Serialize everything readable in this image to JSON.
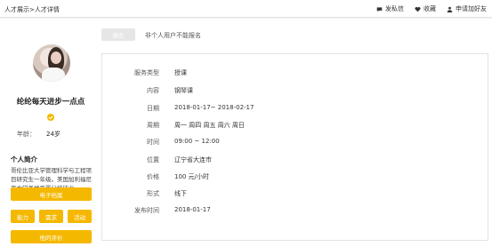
{
  "topbar": {
    "breadcrumb": "人才展示>人才详情",
    "actions": [
      {
        "label": "发私信",
        "icon": "chat-icon"
      },
      {
        "label": "收藏",
        "icon": "heart-icon"
      },
      {
        "label": "申请加好友",
        "icon": "person-icon"
      }
    ]
  },
  "profile": {
    "name": "纶纶每天进步一点点",
    "age_label": "年龄：",
    "age_value": "24岁",
    "intro_title": "个人简介",
    "intro_text": "哥伦比亚大学管理科学与工程项目研究生一年级。美国加利福尼亚大学圣地亚哥分校毕业。",
    "buttons": {
      "resume": "电子档案",
      "ability": "能力",
      "demand": "需求",
      "activity": "活动",
      "review": "他的评价"
    }
  },
  "main": {
    "disabled_button": "报名",
    "notice": "非个人用户不能报名",
    "details": [
      {
        "key": "服务类型",
        "value": "授课"
      },
      {
        "key": "内容",
        "value": "钢琴课"
      },
      {
        "key": "日期",
        "value": "2018-01-17~ 2018-02-17"
      },
      {
        "key": "周期",
        "value": "周一 周四 周五 周六 周日"
      },
      {
        "key": "时间",
        "value": "09:00 ~ 12:00"
      },
      {
        "key": "位置",
        "value": "辽宁省大连市"
      },
      {
        "key": "价格",
        "value": "100 元/小时"
      },
      {
        "key": "形式",
        "value": "线下"
      },
      {
        "key": "发布时间",
        "value": "2018-01-17"
      }
    ]
  },
  "colors": {
    "accent": "#f5b800",
    "disabled": "#e6e6e6",
    "background": "#f2f2f2"
  }
}
